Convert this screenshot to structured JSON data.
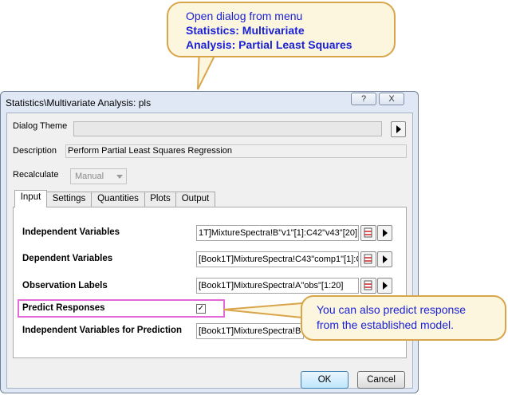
{
  "callout_top": {
    "line1": "Open dialog from menu",
    "line2": "Statistics: Multivariate",
    "line3": "Analysis: Partial Least Squares"
  },
  "window": {
    "title": "Statistics\\Multivariate Analysis: pls",
    "help_label": "?",
    "close_label": "X"
  },
  "dialog_theme": {
    "label": "Dialog Theme",
    "value": ""
  },
  "description": {
    "label": "Description",
    "value": "Perform Partial Least Squares Regression"
  },
  "recalculate": {
    "label": "Recalculate",
    "value": "Manual"
  },
  "tabs": [
    {
      "label": "Input",
      "active": true
    },
    {
      "label": "Settings"
    },
    {
      "label": "Quantities"
    },
    {
      "label": "Plots"
    },
    {
      "label": "Output"
    }
  ],
  "input": {
    "independent_variables": {
      "label": "Independent Variables",
      "value": "1T]MixtureSpectra!B\"v1\"[1]:C42\"v43\"[20]"
    },
    "dependent_variables": {
      "label": "Dependent Variables",
      "value": "[Book1T]MixtureSpectra!C43\"comp1\"[1]:C"
    },
    "observation_labels": {
      "label": "Observation Labels",
      "value": "[Book1T]MixtureSpectra!A\"obs\"[1:20]"
    },
    "predict_responses": {
      "label": "Predict Responses",
      "checked": true,
      "check_glyph": "✓"
    },
    "independent_for_prediction": {
      "label": "Independent Variables for Prediction",
      "value": "[Book1T]MixtureSpectra!B\""
    }
  },
  "buttons": {
    "ok": "OK",
    "cancel": "Cancel"
  },
  "callout_right": {
    "line1": "You can also predict response",
    "line2": "from the established model."
  },
  "colors": {
    "callout_fill": "#fdf6df",
    "callout_border": "#d9a54a",
    "callout_text": "#1a22d6",
    "highlight_border": "#e36ad9"
  },
  "icons": [
    "arrow-right-icon",
    "column-picker-icon",
    "chevron-down-icon",
    "check-icon"
  ]
}
